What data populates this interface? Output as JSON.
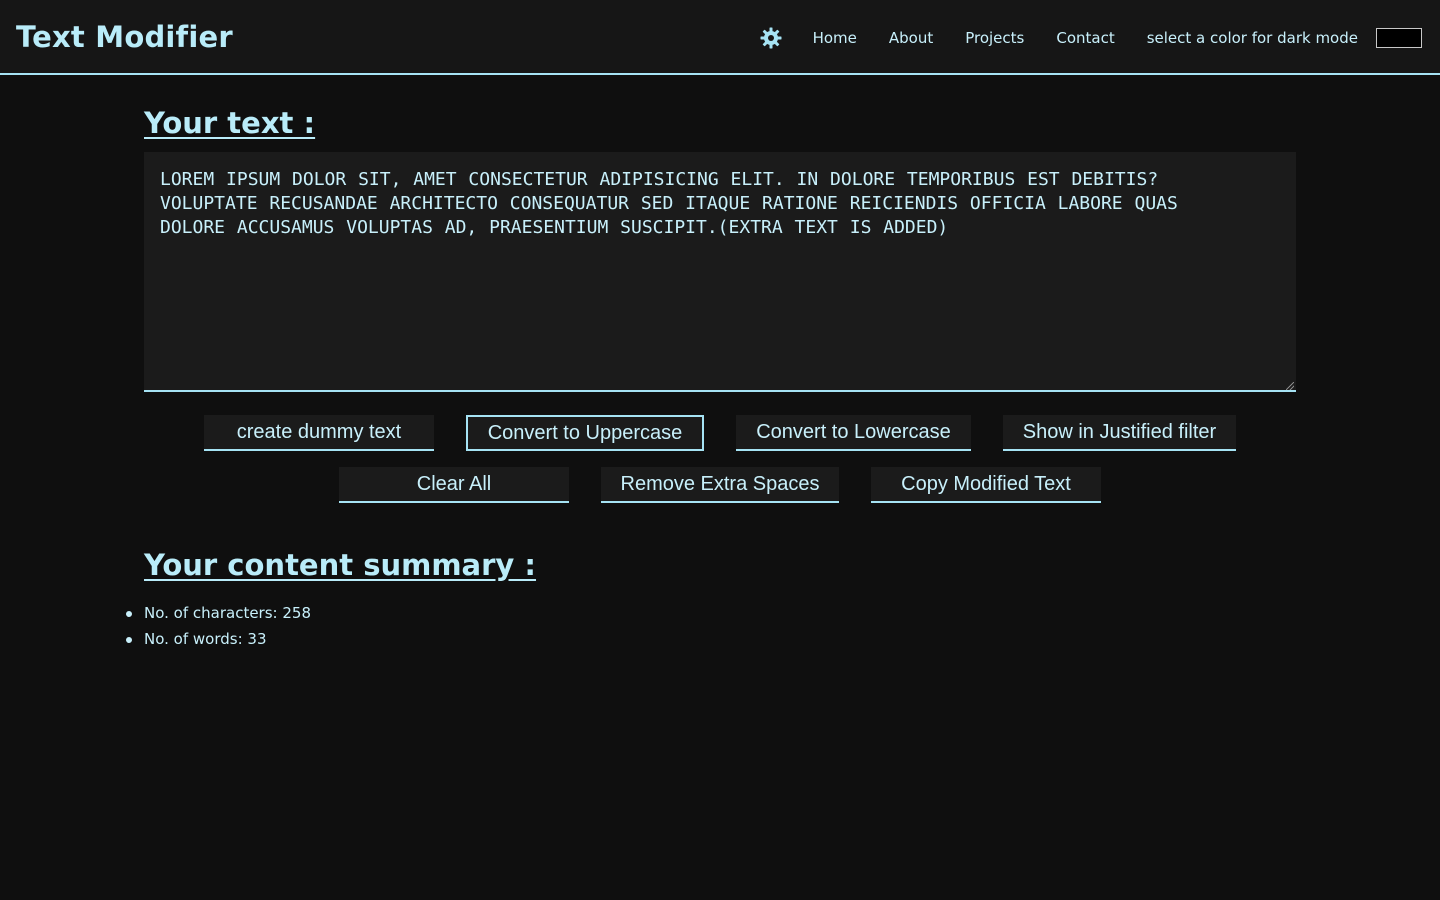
{
  "navbar": {
    "brand": "Text Modifier",
    "theme_icon": "gear-icon",
    "links": [
      "Home",
      "About",
      "Projects",
      "Contact"
    ],
    "mode_label": "select a color for dark mode",
    "mode_color": "#000000"
  },
  "editor": {
    "title": "Your text :",
    "text": "LOREM IPSUM DOLOR SIT, AMET CONSECTETUR ADIPISICING ELIT. IN DOLORE TEMPORIBUS EST DEBITIS?\nVOLUPTATE RECUSANDAE ARCHITECTO CONSEQUATUR SED ITAQUE RATIONE REICIENDIS OFFICIA LABORE QUAS\nDOLORE ACCUSAMUS VOLUPTAS AD, PRAESENTIUM SUSCIPIT.(EXTRA TEXT IS ADDED)"
  },
  "buttons": {
    "row1": [
      "create dummy text",
      "Convert to Uppercase",
      "Convert to Lowercase",
      "Show in Justified filter"
    ],
    "row2": [
      "Clear All",
      "Remove Extra Spaces",
      "Copy Modified Text"
    ]
  },
  "summary": {
    "title": "Your content summary :",
    "characters": "No. of characters: 258",
    "words": "No. of words: 33"
  },
  "colors": {
    "accent": "#a6e3f4",
    "background": "#0f0f0f",
    "surface": "#1b1b1b",
    "navbar": "#161616"
  }
}
